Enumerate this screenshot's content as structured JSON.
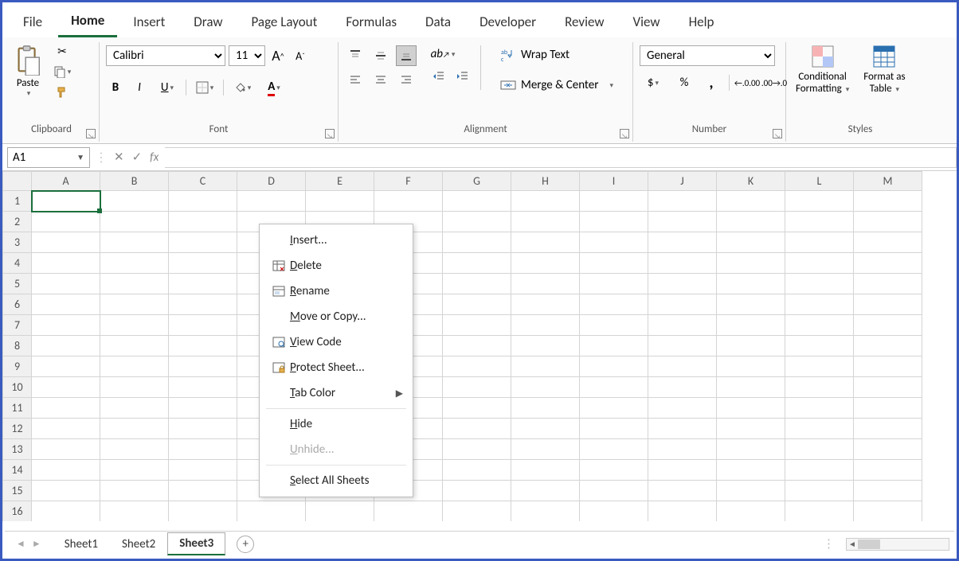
{
  "tabs": {
    "file": "File",
    "home": "Home",
    "insert": "Insert",
    "draw": "Draw",
    "page_layout": "Page Layout",
    "formulas": "Formulas",
    "data": "Data",
    "developer": "Developer",
    "review": "Review",
    "view": "View",
    "help": "Help"
  },
  "clipboard": {
    "paste": "Paste",
    "group": "Clipboard"
  },
  "font": {
    "name": "Calibri",
    "size": "11",
    "group": "Font",
    "bold": "B",
    "italic": "I",
    "underline": "U"
  },
  "alignment": {
    "group": "Alignment",
    "wrap": "Wrap Text",
    "merge": "Merge & Center"
  },
  "number": {
    "group": "Number",
    "format": "General",
    "currency": "$",
    "percent": "%",
    "comma": ","
  },
  "styles": {
    "group": "Styles",
    "conditional_l1": "Conditional",
    "conditional_l2": "Formatting",
    "table_l1": "Format as",
    "table_l2": "Table"
  },
  "name_box": "A1",
  "columns": [
    "A",
    "B",
    "C",
    "D",
    "E",
    "F",
    "G",
    "H",
    "I",
    "J",
    "K",
    "L",
    "M"
  ],
  "rows": [
    "1",
    "2",
    "3",
    "4",
    "5",
    "6",
    "7",
    "8",
    "9",
    "10",
    "11",
    "12",
    "13",
    "14",
    "15",
    "16"
  ],
  "sheets": {
    "s1": "Sheet1",
    "s2": "Sheet2",
    "s3": "Sheet3"
  },
  "context": {
    "insert": "Insert...",
    "delete": "Delete",
    "rename": "Rename",
    "move": "Move or Copy...",
    "view_code": "View Code",
    "protect": "Protect Sheet...",
    "tab_color": "Tab Color",
    "hide": "Hide",
    "unhide": "Unhide...",
    "select_all": "Select All Sheets"
  }
}
